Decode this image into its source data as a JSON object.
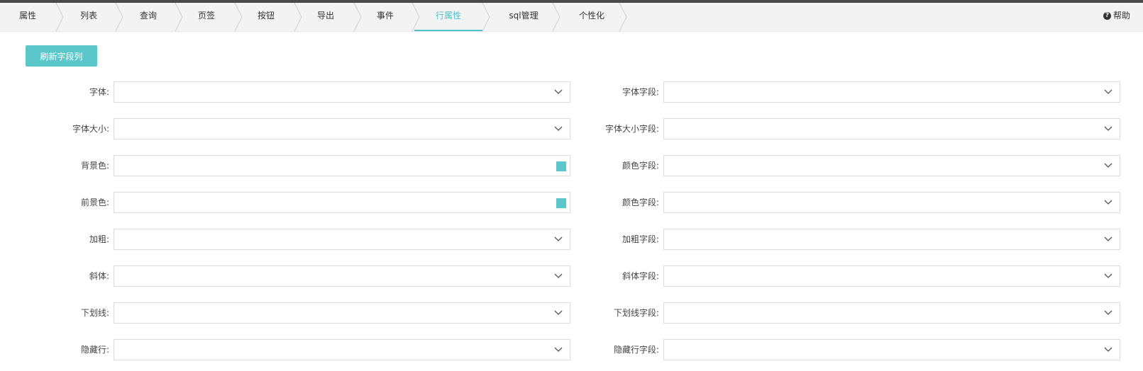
{
  "tabs": [
    {
      "label": "属性"
    },
    {
      "label": "列表"
    },
    {
      "label": "查询"
    },
    {
      "label": "页签"
    },
    {
      "label": "按钮"
    },
    {
      "label": "导出"
    },
    {
      "label": "事件"
    },
    {
      "label": "行属性",
      "active": true
    },
    {
      "label": "sql管理"
    },
    {
      "label": "个性化"
    }
  ],
  "help_label": "帮助",
  "refresh_button": "刷新字段列",
  "accent_color": "#5bc7cb",
  "left_fields": [
    {
      "label": "字体:",
      "value": "",
      "type": "select"
    },
    {
      "label": "字体大小:",
      "value": "",
      "type": "select"
    },
    {
      "label": "背景色:",
      "value": "",
      "type": "color"
    },
    {
      "label": "前景色:",
      "value": "",
      "type": "color"
    },
    {
      "label": "加粗:",
      "value": "",
      "type": "select"
    },
    {
      "label": "斜体:",
      "value": "",
      "type": "select"
    },
    {
      "label": "下划线:",
      "value": "",
      "type": "select"
    },
    {
      "label": "隐藏行:",
      "value": "",
      "type": "select"
    }
  ],
  "right_fields": [
    {
      "label": "字体字段:",
      "value": "",
      "type": "select"
    },
    {
      "label": "字体大小字段:",
      "value": "",
      "type": "select"
    },
    {
      "label": "颜色字段:",
      "value": "",
      "type": "select"
    },
    {
      "label": "颜色字段:",
      "value": "",
      "type": "select"
    },
    {
      "label": "加粗字段:",
      "value": "",
      "type": "select"
    },
    {
      "label": "斜体字段:",
      "value": "",
      "type": "select"
    },
    {
      "label": "下划线字段:",
      "value": "",
      "type": "select"
    },
    {
      "label": "隐藏行字段:",
      "value": "",
      "type": "select"
    }
  ]
}
